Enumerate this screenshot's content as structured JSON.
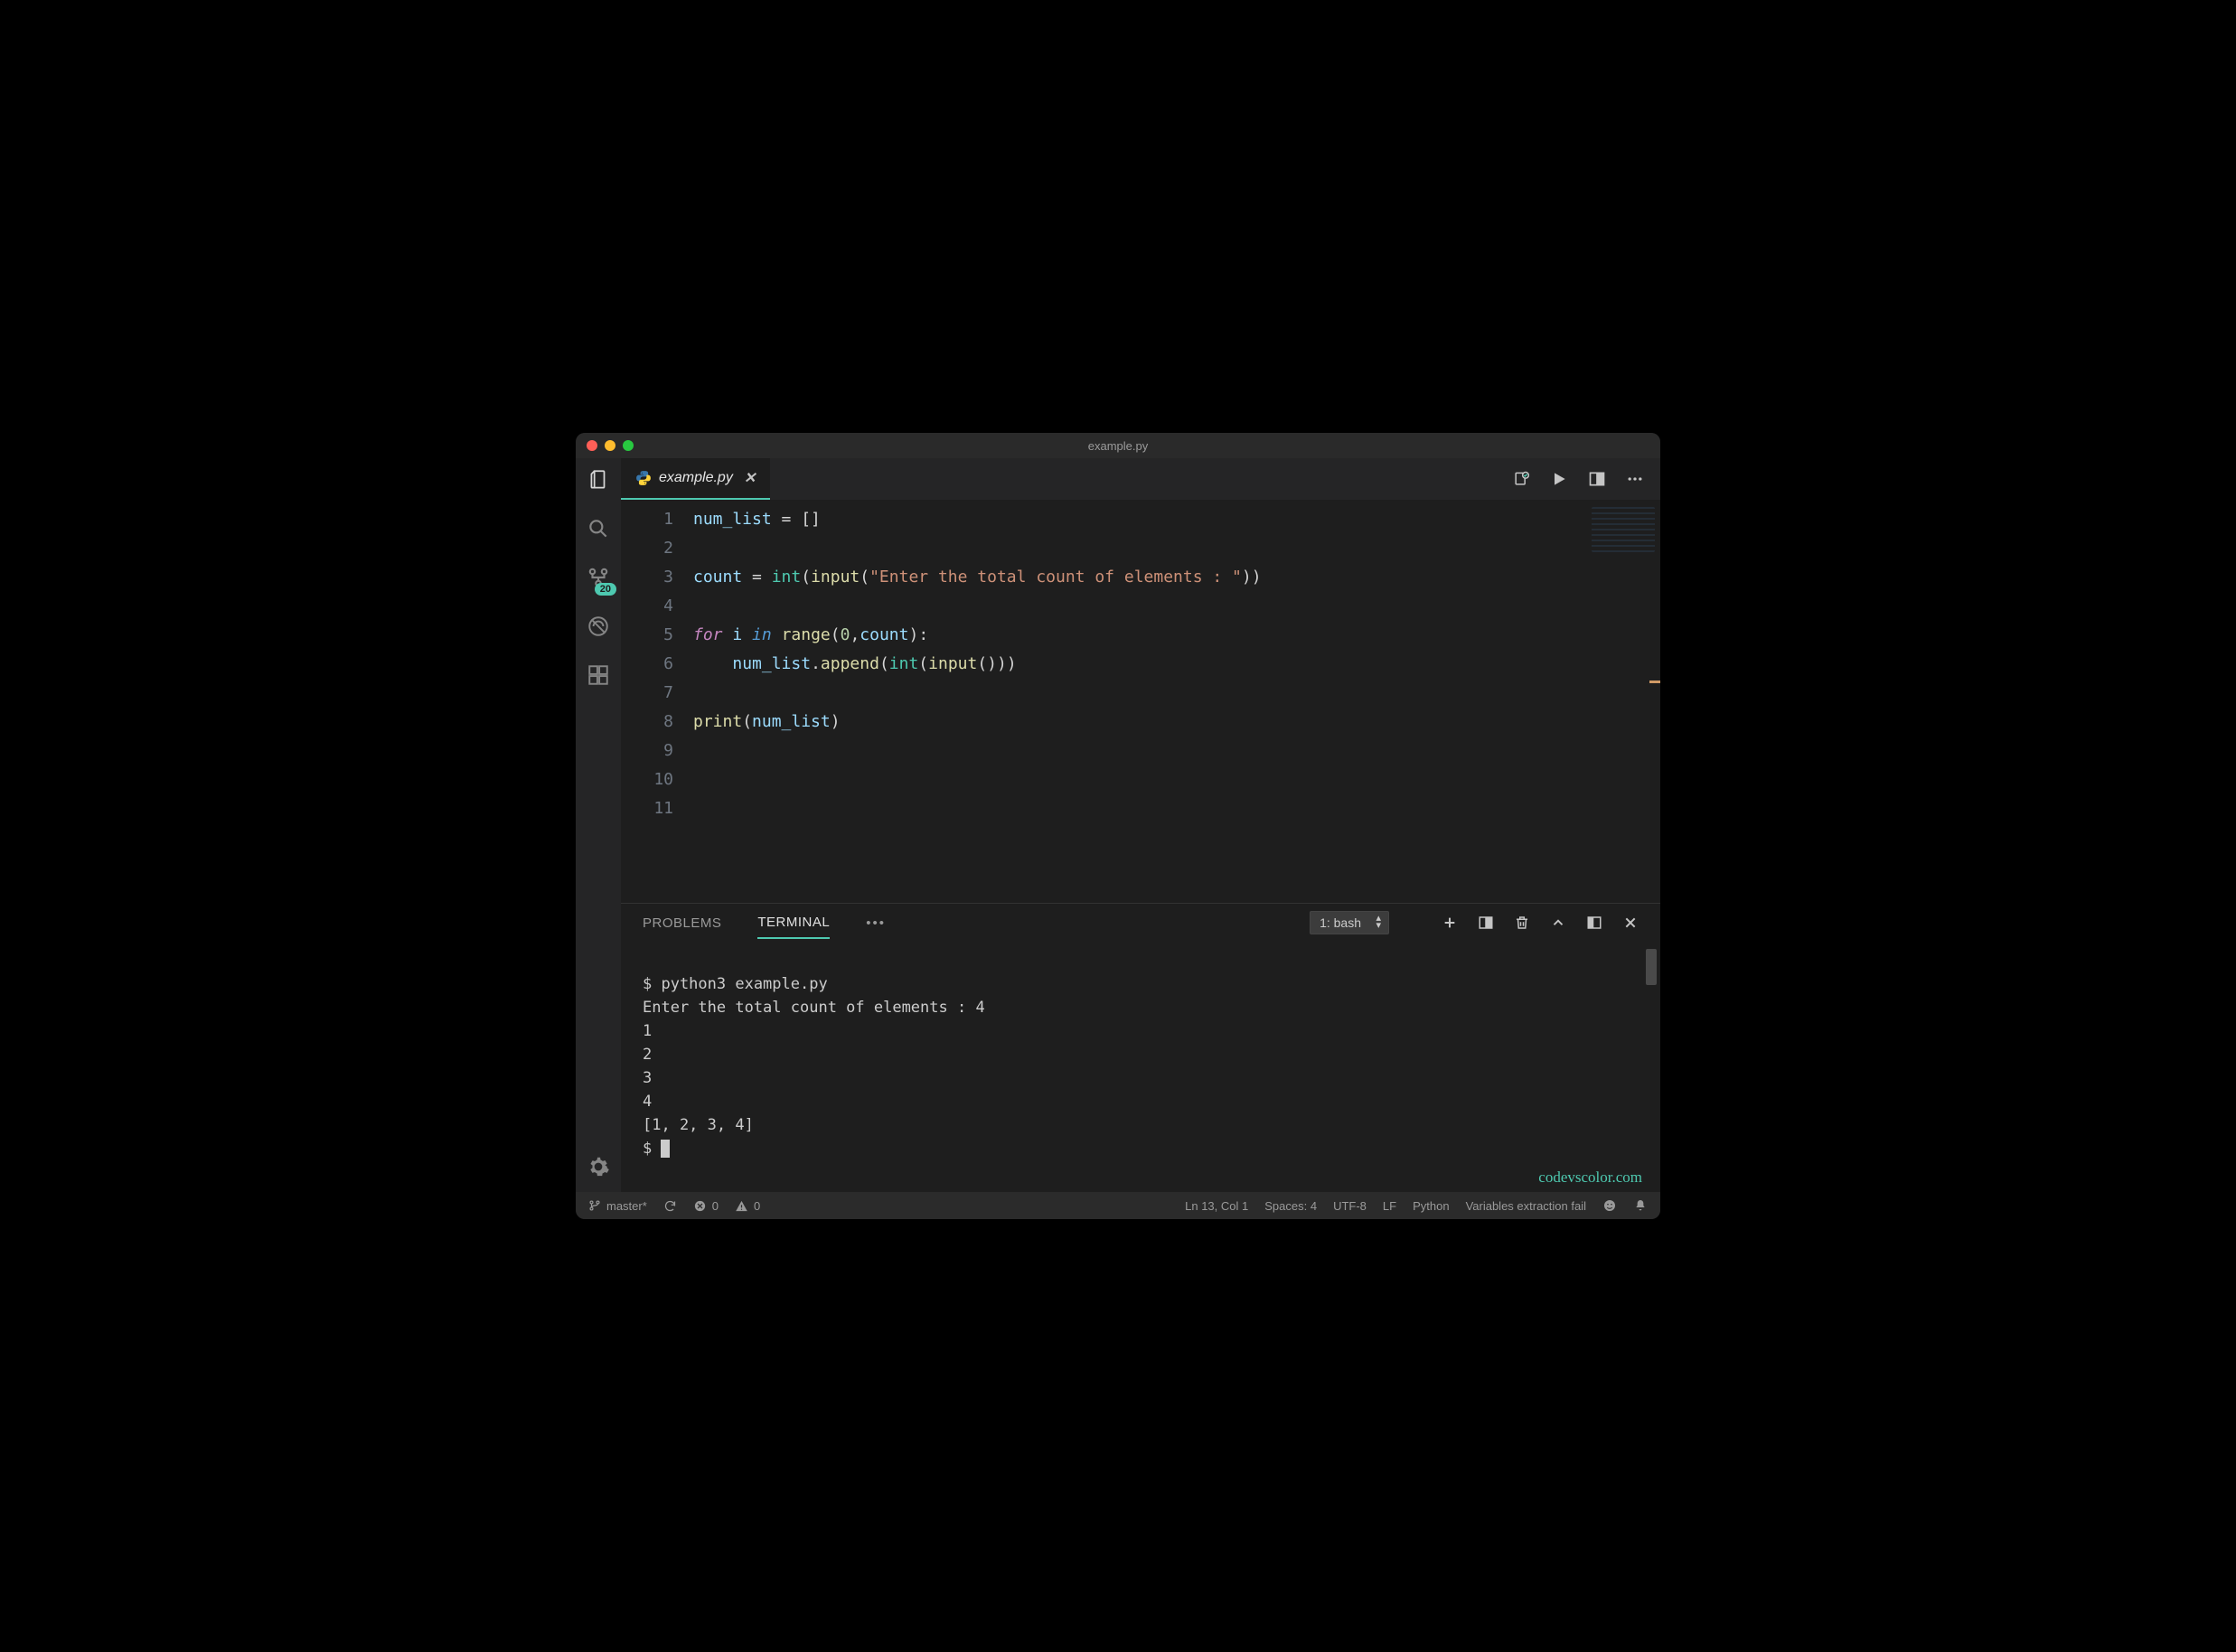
{
  "window": {
    "title": "example.py"
  },
  "activitybar": {
    "scm_badge": "20"
  },
  "tab": {
    "filename": "example.py"
  },
  "editor": {
    "lines": [
      "1",
      "2",
      "3",
      "4",
      "5",
      "6",
      "7",
      "8",
      "9",
      "10",
      "11"
    ]
  },
  "code": {
    "l1_var": "num_list",
    "l1_eq": " = ",
    "l1_br": "[]",
    "l3_var": "count",
    "l3_eq": " = ",
    "l3_int": "int",
    "l3_p1": "(",
    "l3_input": "input",
    "l3_p2": "(",
    "l3_str": "\"Enter the total count of elements : \"",
    "l3_p3": "))",
    "l5_for": "for",
    "l5_sp1": " ",
    "l5_i": "i",
    "l5_sp2": " ",
    "l5_in": "in",
    "l5_sp3": " ",
    "l5_range": "range",
    "l5_p1": "(",
    "l5_n0": "0",
    "l5_comma": ",",
    "l5_count": "count",
    "l5_p2": "):",
    "l6_indent": "    ",
    "l6_var": "num_list",
    "l6_dot": ".",
    "l6_append": "append",
    "l6_p1": "(",
    "l6_int": "int",
    "l6_p2": "(",
    "l6_input": "input",
    "l6_p3": "()))",
    "l8_print": "print",
    "l8_p1": "(",
    "l8_var": "num_list",
    "l8_p2": ")"
  },
  "panel": {
    "tabs": {
      "problems": "PROBLEMS",
      "terminal": "TERMINAL",
      "more": "•••"
    },
    "terminal_selector": "1: bash"
  },
  "terminal": {
    "line1": "$ python3 example.py",
    "line2": "Enter the total count of elements : 4",
    "line3": "1",
    "line4": "2",
    "line5": "3",
    "line6": "4",
    "line7": "[1, 2, 3, 4]",
    "prompt": "$ "
  },
  "watermark": "codevscolor.com",
  "status": {
    "branch": "master*",
    "errors": "0",
    "warnings": "0",
    "cursor": "Ln 13, Col 1",
    "spaces": "Spaces: 4",
    "encoding": "UTF-8",
    "eol": "LF",
    "language": "Python",
    "extra": "Variables extraction fail"
  }
}
